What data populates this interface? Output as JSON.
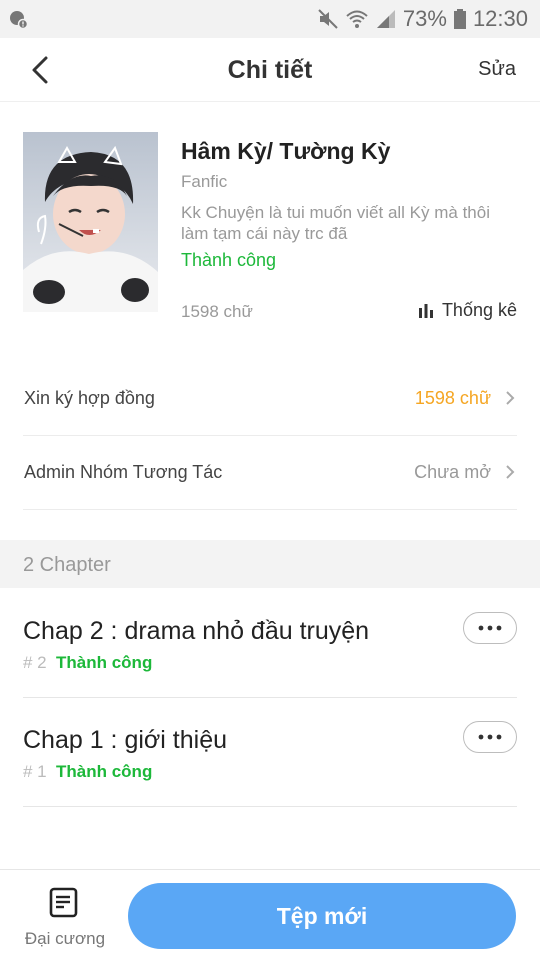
{
  "status_bar": {
    "battery": "73%",
    "time": "12:30",
    "icons": [
      "notification-icon",
      "mute-icon",
      "wifi-icon",
      "signal-icon",
      "battery-icon"
    ]
  },
  "header": {
    "back_icon": "chevron-left-icon",
    "title": "Chi tiết",
    "edit_label": "Sửa"
  },
  "book": {
    "name": "Hâm Kỳ/ Tường Kỳ",
    "genre": "Fanfic",
    "description_line1": "Kk Chuyện là tui muốn viết all Kỳ mà thôi",
    "description_line2": "làm tạm cái này trc đã",
    "status": "Thành công",
    "word_count": "1598 chữ",
    "stats_label": "Thống kê",
    "stats_icon": "bar-chart-icon"
  },
  "rows": [
    {
      "label": "Xin ký hợp đồng",
      "value": "1598 chữ",
      "value_color": "#f5a623"
    },
    {
      "label": "Admin Nhóm Tương Tác",
      "value": "Chưa mở",
      "value_color": "#999999"
    }
  ],
  "chapters_section": {
    "title": "2 Chapter"
  },
  "chapters": [
    {
      "title": "Chap 2 : drama nhỏ đầu truyện",
      "number": "# 2",
      "status": "Thành công"
    },
    {
      "title": "Chap 1 : giới thiệu",
      "number": "# 1",
      "status": "Thành công"
    }
  ],
  "bottom_bar": {
    "outline_label": "Đại cương",
    "outline_icon": "document-list-icon",
    "new_button_label": "Tệp mới"
  },
  "colors": {
    "success": "#1db83a",
    "accent": "#5aa7f5",
    "highlight": "#f5a623"
  }
}
